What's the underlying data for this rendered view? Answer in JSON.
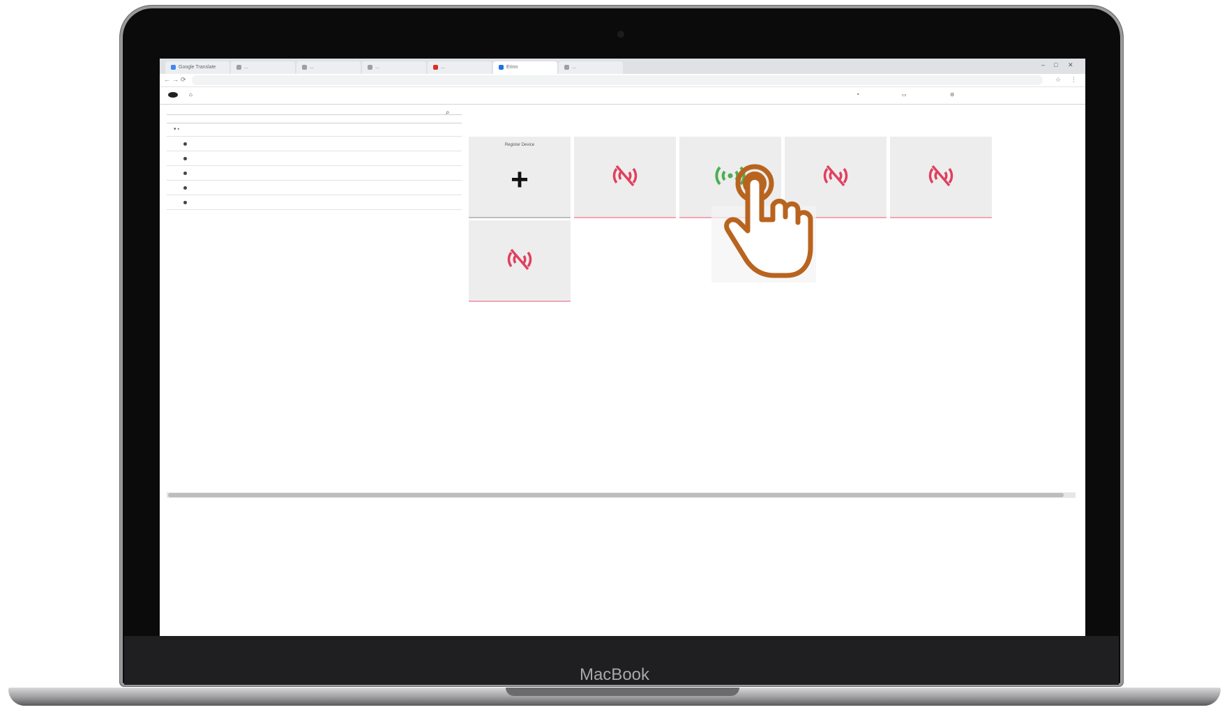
{
  "device": {
    "brand": "MacBook"
  },
  "browser": {
    "tabs": [
      {
        "label": "Google Translate",
        "active": false,
        "fav": "#4285f4"
      },
      {
        "label": "...",
        "active": false,
        "fav": "#9aa0a6"
      },
      {
        "label": "...",
        "active": false,
        "fav": "#9aa0a6"
      },
      {
        "label": "...",
        "active": false,
        "fav": "#9aa0a6"
      },
      {
        "label": "...",
        "active": false,
        "fav": "#d93025"
      },
      {
        "label": "Erinn",
        "active": true,
        "fav": "#1a73e8"
      },
      {
        "label": "...",
        "active": false,
        "fav": "#9aa0a6"
      }
    ],
    "url": ""
  },
  "app": {
    "home_label": "",
    "header_buttons": [
      "",
      "",
      ""
    ]
  },
  "sidebar": {
    "root_label": "",
    "items": [
      "",
      "",
      "",
      "",
      ""
    ]
  },
  "tiles": [
    {
      "type": "add",
      "name": "Register Device"
    },
    {
      "type": "device",
      "name": "",
      "status": "offline",
      "status_label": "",
      "meta": ""
    },
    {
      "type": "device",
      "name": "",
      "status": "online",
      "status_label": "",
      "meta": ""
    },
    {
      "type": "device",
      "name": "",
      "status": "offline",
      "status_label": "",
      "meta": ""
    },
    {
      "type": "device",
      "name": "",
      "status": "offline",
      "status_label": "",
      "meta": ""
    },
    {
      "type": "device",
      "name": "",
      "status": "offline",
      "status_label": "",
      "meta": ""
    }
  ],
  "colors": {
    "offline": "#e0405e",
    "online": "#4caf50",
    "hand_cursor": "#b8641f"
  }
}
